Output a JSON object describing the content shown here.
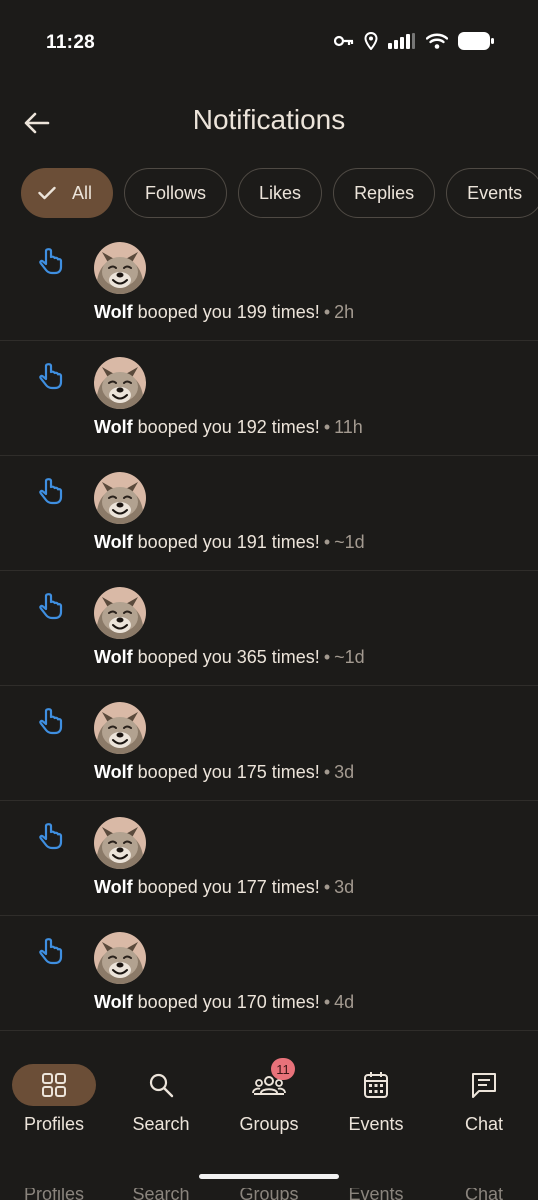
{
  "status_bar": {
    "time": "11:28"
  },
  "header": {
    "title": "Notifications"
  },
  "filters": {
    "chips": [
      {
        "label": "All",
        "selected": true
      },
      {
        "label": "Follows",
        "selected": false
      },
      {
        "label": "Likes",
        "selected": false
      },
      {
        "label": "Replies",
        "selected": false
      },
      {
        "label": "Events",
        "selected": false
      }
    ]
  },
  "notifications": [
    {
      "user": "Wolf",
      "message": "booped you 199 times!",
      "time": "2h"
    },
    {
      "user": "Wolf",
      "message": "booped you 192 times!",
      "time": "11h"
    },
    {
      "user": "Wolf",
      "message": "booped you 191 times!",
      "time": "~1d"
    },
    {
      "user": "Wolf",
      "message": "booped you 365 times!",
      "time": "~1d"
    },
    {
      "user": "Wolf",
      "message": "booped you 175 times!",
      "time": "3d"
    },
    {
      "user": "Wolf",
      "message": "booped you 177 times!",
      "time": "3d"
    },
    {
      "user": "Wolf",
      "message": "booped you 170 times!",
      "time": "4d"
    }
  ],
  "bottom_nav": {
    "items": [
      {
        "label": "Profiles",
        "icon": "grid-icon",
        "active": true
      },
      {
        "label": "Search",
        "icon": "search-icon",
        "active": false
      },
      {
        "label": "Groups",
        "icon": "groups-icon",
        "active": false,
        "badge": "11"
      },
      {
        "label": "Events",
        "icon": "calendar-icon",
        "active": false
      },
      {
        "label": "Chat",
        "icon": "chat-icon",
        "active": false
      }
    ]
  },
  "colors": {
    "background": "#1c1b19",
    "accent": "#6b4e37",
    "boop_icon": "#3f8fe0",
    "badge": "#e8727a",
    "text": "#ece4da"
  }
}
